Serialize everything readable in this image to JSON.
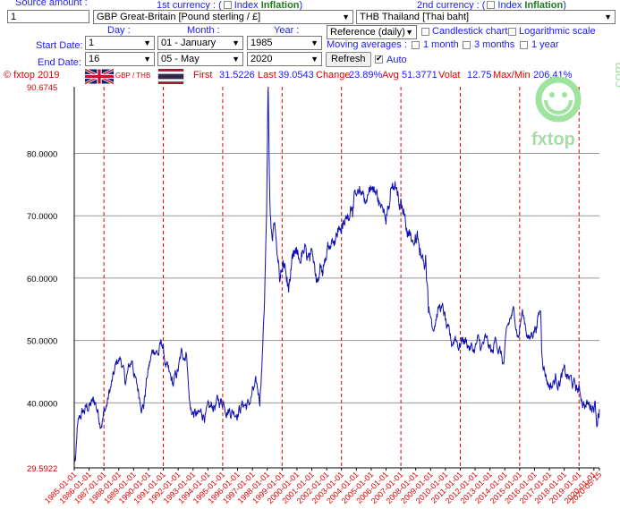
{
  "form": {
    "source_amount_label": "Source amount :",
    "source_amount_value": "1",
    "first_currency_label": "1st currency : (",
    "second_currency_label": "2nd currency : (",
    "index_label": "Index",
    "inflation_label": "Inflation",
    "close_paren": ")",
    "first_currency_value": "GBP Great-Britain [Pound sterling / £]",
    "second_currency_value": "THB Thailand [Thai baht]",
    "day_label": "Day :",
    "month_label": "Month :",
    "year_label": "Year :",
    "start_date_label": "Start Date:",
    "end_date_label": "End Date:",
    "start_day": "1",
    "start_month": "01 - January",
    "start_year": "1985",
    "end_day": "16",
    "end_month": "05 - May",
    "end_year": "2020",
    "reference_value": "Reference (daily)",
    "candlestick_label": "Candlestick chart",
    "log_label": "Logarithmic scale",
    "moving_averages_label": "Moving averages :",
    "ma_1month": "1 month",
    "ma_3months": "3 months",
    "ma_1year": "1 year",
    "refresh_label": "Refresh",
    "auto_label": "Auto"
  },
  "stats": {
    "copyright": "© fxtop 2019",
    "pair": "GBP / THB",
    "first_label": "First",
    "first_value": "31.5226",
    "last_label": "Last",
    "last_value": "39.0543",
    "change_label": "Change",
    "change_value": "23.89%",
    "avg_label": "Avg",
    "avg_value": "51.3771",
    "volat_label": "Volat",
    "volat_value": "12.75",
    "maxmin_label": "Max/Min",
    "maxmin_value": "206.41%"
  },
  "logo": {
    "text": "fxtop",
    "suffix": ".com"
  },
  "colors": {
    "line": "#1010b0",
    "gridline": "#e00000",
    "hgrid": "#999999",
    "label": "#1a1aff",
    "red": "#e00000"
  },
  "chart_data": {
    "type": "line",
    "y_min": 29.5922,
    "y_max": 90.6745,
    "x_range": [
      "1985-01-01",
      "2020-05-16"
    ],
    "y_tick_labels": [
      "29.5922",
      "40.0000",
      "50.0000",
      "60.0000",
      "70.0000",
      "80.0000",
      "90.6745"
    ],
    "y_tick_values": [
      29.5922,
      40,
      50,
      60,
      70,
      80,
      90.6745
    ],
    "x_tick_labels": [
      "1985-01-01",
      "1986-01-01",
      "1987-01-01",
      "1988-01-01",
      "1989-01-01",
      "1990-01-01",
      "1991-01-01",
      "1992-01-01",
      "1993-01-01",
      "1994-01-01",
      "1995-01-01",
      "1996-01-01",
      "1997-01-01",
      "1998-01-01",
      "1999-01-01",
      "2000-01-01",
      "2001-01-01",
      "2002-01-01",
      "2003-01-01",
      "2004-01-01",
      "2005-01-01",
      "2006-01-01",
      "2007-01-01",
      "2008-01-01",
      "2009-01-01",
      "2010-01-01",
      "2011-01-01",
      "2012-01-01",
      "2013-01-01",
      "2014-01-01",
      "2015-01-01",
      "2016-01-01",
      "2017-01-01",
      "2018-01-01",
      "2019-01-01",
      "2020-01-01",
      "2020-05-15"
    ],
    "vertical_gridline_years": [
      1987,
      1991,
      1995,
      1999,
      2003,
      2007,
      2011,
      2015,
      2019
    ],
    "series": [
      {
        "x": [
          "1985-01-01",
          "1985-02-01",
          "1985-03-15",
          "1985-06-01",
          "1985-09-01",
          "1986-01-01",
          "1986-06-01",
          "1986-10-01",
          "1987-03-01",
          "1987-06-01",
          "1987-09-01",
          "1987-12-01",
          "1988-03-01",
          "1988-06-01",
          "1988-09-01",
          "1988-12-01",
          "1989-03-01",
          "1989-06-01",
          "1989-09-01",
          "1989-12-01",
          "1990-03-01",
          "1990-06-01",
          "1990-09-01",
          "1990-12-01",
          "1991-03-01",
          "1991-06-01",
          "1991-09-01",
          "1992-01-01",
          "1992-04-01",
          "1992-08-01",
          "1992-09-20",
          "1992-11-01",
          "1993-03-01",
          "1993-06-01",
          "1993-10-01",
          "1994-02-01",
          "1994-06-01",
          "1994-10-01",
          "1995-02-01",
          "1995-06-01",
          "1995-10-01",
          "1996-02-01",
          "1996-06-01",
          "1996-10-01",
          "1997-01-01",
          "1997-04-01",
          "1997-07-01",
          "1997-07-20",
          "1997-09-01",
          "1997-10-15",
          "1997-11-15",
          "1997-12-15",
          "1998-01-12",
          "1998-01-25",
          "1998-02-15",
          "1998-03-15",
          "1998-05-01",
          "1998-07-01",
          "1998-09-01",
          "1998-11-01",
          "1999-01-01",
          "1999-03-01",
          "1999-06-01",
          "1999-09-01",
          "1999-12-01",
          "2000-03-01",
          "2000-06-01",
          "2000-09-01",
          "2000-12-01",
          "2001-03-01",
          "2001-06-01",
          "2001-09-01",
          "2001-12-01",
          "2002-03-01",
          "2002-06-01",
          "2002-09-01",
          "2002-12-01",
          "2003-03-01",
          "2003-06-01",
          "2003-09-01",
          "2003-12-01",
          "2004-03-01",
          "2004-06-01",
          "2004-09-01",
          "2004-12-01",
          "2005-03-01",
          "2005-06-01",
          "2005-09-01",
          "2005-12-01",
          "2006-03-01",
          "2006-06-01",
          "2006-09-01",
          "2006-12-01",
          "2007-03-01",
          "2007-06-01",
          "2007-09-01",
          "2007-12-01",
          "2008-03-01",
          "2008-06-01",
          "2008-09-01",
          "2008-12-01",
          "2009-03-01",
          "2009-06-01",
          "2009-09-01",
          "2009-12-01",
          "2010-03-01",
          "2010-06-01",
          "2010-09-01",
          "2010-12-01",
          "2011-03-01",
          "2011-06-01",
          "2011-09-01",
          "2011-12-01",
          "2012-03-01",
          "2012-06-01",
          "2012-09-01",
          "2012-12-01",
          "2013-03-01",
          "2013-06-01",
          "2013-09-01",
          "2013-12-01",
          "2014-03-01",
          "2014-06-01",
          "2014-09-01",
          "2014-12-01",
          "2015-03-01",
          "2015-06-01",
          "2015-09-01",
          "2015-12-01",
          "2016-03-01",
          "2016-06-01",
          "2016-06-24",
          "2016-09-01",
          "2016-12-01",
          "2017-03-01",
          "2017-06-01",
          "2017-09-01",
          "2017-12-01",
          "2018-03-01",
          "2018-06-01",
          "2018-09-01",
          "2018-12-01",
          "2019-03-01",
          "2019-06-01",
          "2019-09-01",
          "2019-12-01",
          "2020-02-01",
          "2020-03-20",
          "2020-04-15",
          "2020-05-16"
        ],
        "values": [
          31.5,
          30.0,
          35.0,
          37.5,
          38.5,
          39.5,
          40.0,
          37.5,
          39.5,
          42.0,
          44.0,
          46.5,
          47.0,
          43.0,
          45.0,
          47.0,
          43.0,
          41.0,
          40.0,
          44.5,
          47.0,
          49.0,
          48.0,
          49.5,
          46.0,
          43.5,
          42.5,
          45.0,
          47.5,
          48.5,
          42.0,
          39.0,
          38.0,
          37.5,
          38.5,
          38.0,
          39.5,
          40.0,
          40.5,
          39.5,
          39.0,
          39.5,
          40.0,
          39.5,
          41.5,
          42.0,
          40.5,
          43.0,
          48.0,
          55.0,
          62.0,
          70.0,
          85.0,
          90.6,
          78.0,
          70.0,
          66.0,
          70.0,
          64.0,
          60.0,
          61.0,
          62.0,
          58.0,
          61.5,
          63.0,
          62.5,
          64.0,
          63.0,
          62.0,
          62.0,
          60.5,
          63.0,
          64.0,
          65.5,
          67.0,
          67.0,
          68.5,
          68.0,
          70.0,
          72.5,
          73.0,
          72.0,
          73.5,
          72.5,
          75.0,
          74.0,
          73.0,
          71.0,
          71.5,
          72.0,
          74.0,
          74.0,
          71.0,
          70.5,
          68.5,
          67.0,
          66.0,
          65.5,
          62.0,
          63.5,
          55.0,
          53.0,
          55.0,
          55.5,
          54.0,
          50.5,
          49.0,
          51.0,
          49.5,
          50.5,
          50.0,
          49.0,
          48.5,
          49.5,
          48.5,
          49.5,
          48.5,
          47.5,
          50.5,
          48.5,
          46.0,
          51.0,
          53.5,
          54.0,
          51.0,
          54.5,
          52.5,
          50.0,
          52.0,
          53.0,
          55.0,
          49.0,
          46.0,
          43.5,
          43.0,
          44.0,
          44.0,
          44.5,
          44.0,
          43.5,
          42.5,
          42.0,
          41.0,
          40.0,
          39.5,
          40.0,
          40.5,
          37.0,
          39.5,
          39.0
        ]
      }
    ],
    "grid": true,
    "legend": "none"
  }
}
